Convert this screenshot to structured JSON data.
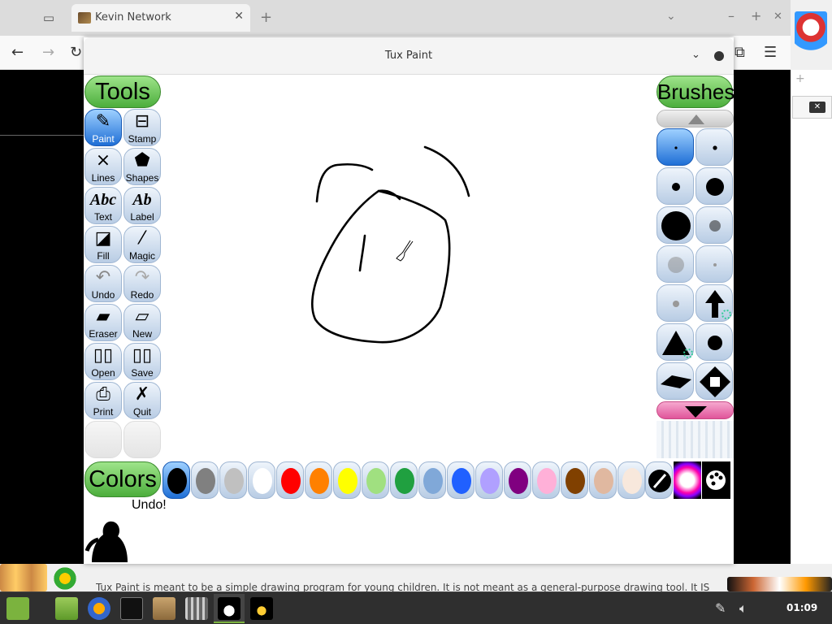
{
  "browser": {
    "tab_title": "Kevin Network",
    "tab_close": "✕",
    "new_tab": "+",
    "chevron": "⌄",
    "win_min": "–",
    "win_max": "+",
    "win_close": "✕",
    "nav_back": "←",
    "nav_forward": "→",
    "nav_reload": "↻",
    "ext_icon": "puzzle-icon",
    "menu_icon": "☰",
    "page_text_below": "Tux Paint is meant to be a simple drawing program for young children. It is not meant as a general-purpose drawing tool. It IS"
  },
  "tuxpaint": {
    "window_title": "Tux Paint",
    "tools_header": "Tools",
    "brushes_header": "Brushes",
    "colors_header": "Colors",
    "status_message": "Undo!",
    "tools": [
      {
        "label": "Paint",
        "icon": "paintbrush-icon"
      },
      {
        "label": "Stamp",
        "icon": "stamp-icon"
      },
      {
        "label": "Lines",
        "icon": "lines-icon"
      },
      {
        "label": "Shapes",
        "icon": "pentagon-icon"
      },
      {
        "label": "Text",
        "icon": "text-abc-icon",
        "glyph": "Abc"
      },
      {
        "label": "Label",
        "icon": "label-abc-icon",
        "glyph": "Ab"
      },
      {
        "label": "Fill",
        "icon": "paint-bucket-icon"
      },
      {
        "label": "Magic",
        "icon": "magic-wand-icon"
      },
      {
        "label": "Undo",
        "icon": "undo-icon"
      },
      {
        "label": "Redo",
        "icon": "redo-icon"
      },
      {
        "label": "Eraser",
        "icon": "eraser-icon"
      },
      {
        "label": "New",
        "icon": "new-page-icon"
      },
      {
        "label": "Open",
        "icon": "open-book-icon"
      },
      {
        "label": "Save",
        "icon": "save-book-icon"
      },
      {
        "label": "Print",
        "icon": "printer-icon"
      },
      {
        "label": "Quit",
        "icon": "quit-x-icon"
      }
    ],
    "colors": [
      "#000000",
      "#808080",
      "#c0c0c0",
      "#ffffff",
      "#ff0000",
      "#ff8000",
      "#ffff00",
      "#a0e080",
      "#20a040",
      "#80a8d8",
      "#2060ff",
      "#b0a0ff",
      "#800080",
      "#ffb0d8",
      "#804000",
      "#e0b8a0",
      "#f8e8dc"
    ],
    "selected_color": "#000000",
    "accent_selected": "#1f6fd6",
    "header_green": "#4cae3c",
    "scroll_down_color": "#e0559a"
  },
  "taskbar": {
    "clock": "01:09",
    "apps": [
      "mint-menu-icon",
      "files-icon",
      "firefox-icon",
      "terminal-icon",
      "archive-manager-icon",
      "mixer-icon",
      "tuxpaint-icon",
      "tux-icon"
    ]
  }
}
